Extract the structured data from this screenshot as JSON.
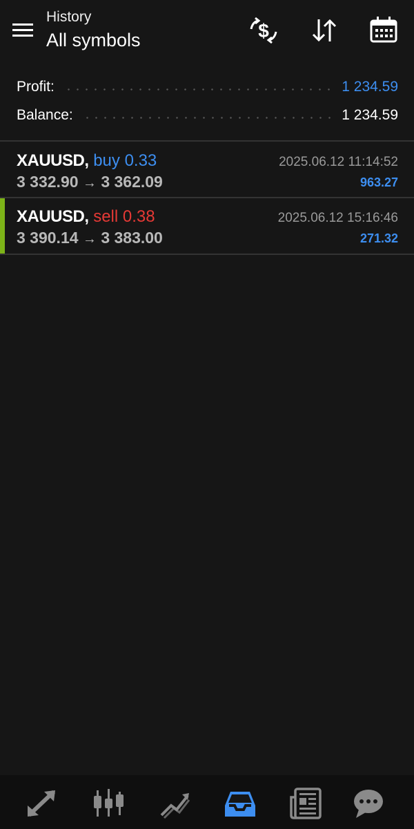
{
  "header": {
    "subtitle": "History",
    "title": "All symbols"
  },
  "summary": {
    "profit_label": "Profit:",
    "profit_value": "1 234.59",
    "balance_label": "Balance:",
    "balance_value": "1 234.59"
  },
  "deals": [
    {
      "symbol": "XAUUSD,",
      "side": "buy",
      "volume": "0.33",
      "open_price": "3 332.90",
      "arrow": "→",
      "close_price": "3 362.09",
      "time": "2025.06.12 11:14:52",
      "profit": "963.27"
    },
    {
      "symbol": "XAUUSD,",
      "side": "sell",
      "volume": "0.38",
      "open_price": "3 390.14",
      "arrow": "→",
      "close_price": "3 383.00",
      "time": "2025.06.12 15:16:46",
      "profit": "271.32"
    }
  ],
  "icons": {
    "menu": "hamburger-menu-icon",
    "deposit": "dollar-exchange-icon",
    "sort": "sort-arrows-icon",
    "calendar": "calendar-icon",
    "nav_quotes": "quotes-arrows-icon",
    "nav_chart": "candlestick-chart-icon",
    "nav_trade": "trade-trend-icon",
    "nav_history": "history-inbox-icon",
    "nav_news": "news-icon",
    "nav_messages": "chat-bubble-icon"
  },
  "colors": {
    "background": "#161616",
    "accent_blue": "#3d8ef0",
    "sell_red": "#e53935",
    "active_green": "#7cb318",
    "nav_inactive": "#8a8a8a"
  }
}
